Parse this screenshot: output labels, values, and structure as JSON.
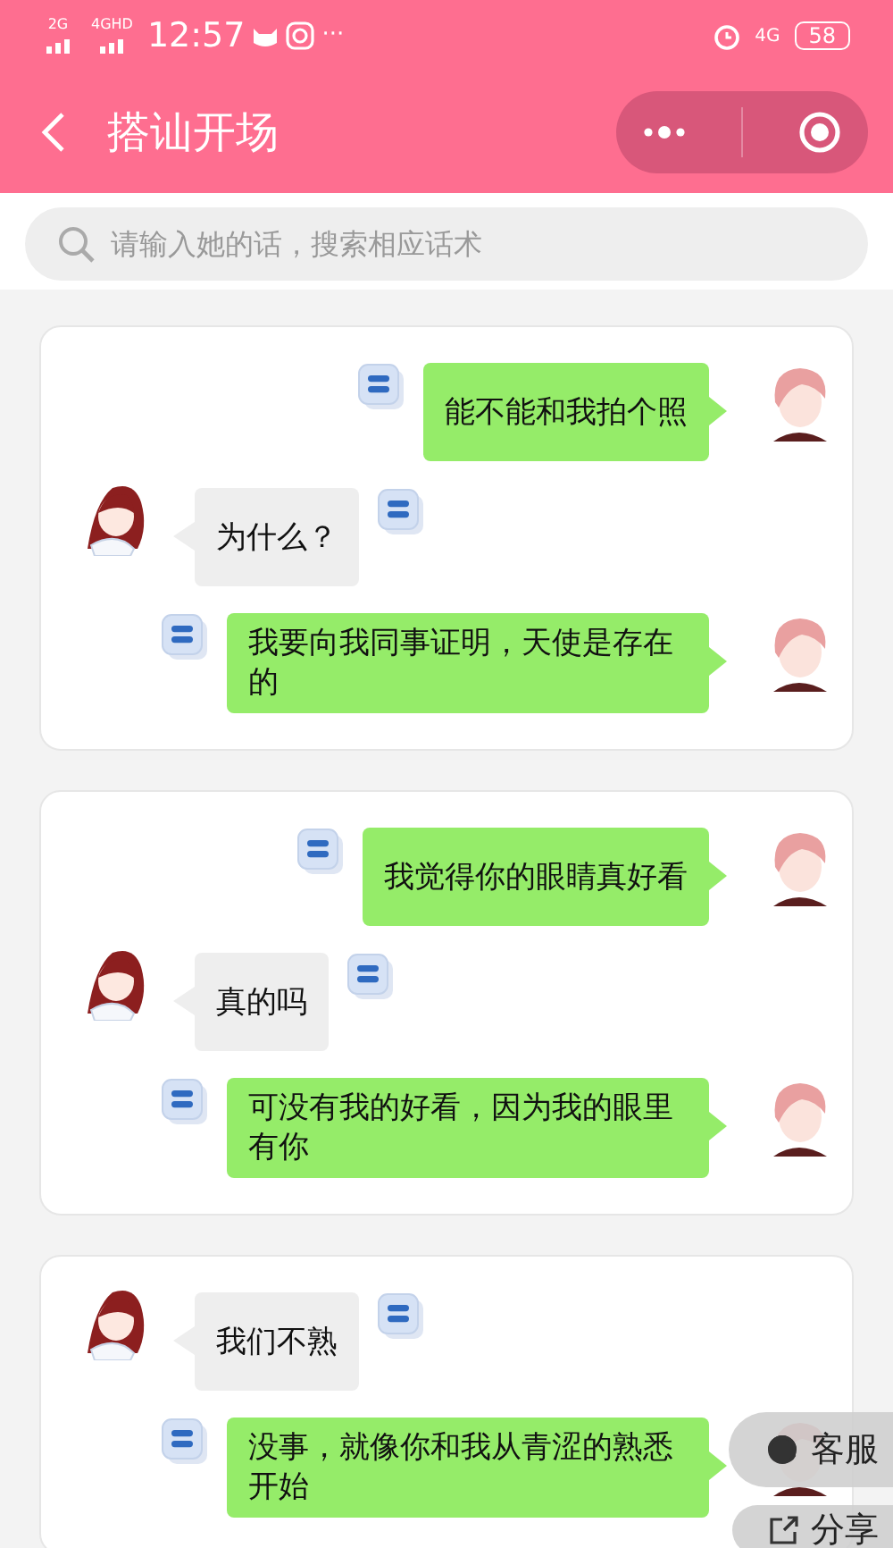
{
  "status_bar": {
    "network_1": "2G",
    "network_2": "4GHD",
    "time": "12:57",
    "more": "···",
    "network_3": "4G",
    "battery": "58"
  },
  "header": {
    "title": "搭讪开场"
  },
  "search": {
    "placeholder": "请输入她的话，搜索相应话术"
  },
  "cards": [
    {
      "messages": [
        {
          "kind": "sent",
          "text": "能不能和我拍个照"
        },
        {
          "kind": "received",
          "text": "为什么？"
        },
        {
          "kind": "sent",
          "text": "我要向我同事证明，天使是存在的"
        }
      ]
    },
    {
      "messages": [
        {
          "kind": "sent",
          "text": "我觉得你的眼睛真好看"
        },
        {
          "kind": "received",
          "text": "真的吗"
        },
        {
          "kind": "sent",
          "text": "可没有我的好看，因为我的眼里有你"
        }
      ]
    },
    {
      "messages": [
        {
          "kind": "received",
          "text": "我们不熟"
        },
        {
          "kind": "sent",
          "text": "没事，就像你和我从青涩的熟悉开始"
        }
      ]
    }
  ],
  "floating_buttons": [
    {
      "kind": "service",
      "label": "客服"
    },
    {
      "kind": "share",
      "label": "分享"
    }
  ]
}
